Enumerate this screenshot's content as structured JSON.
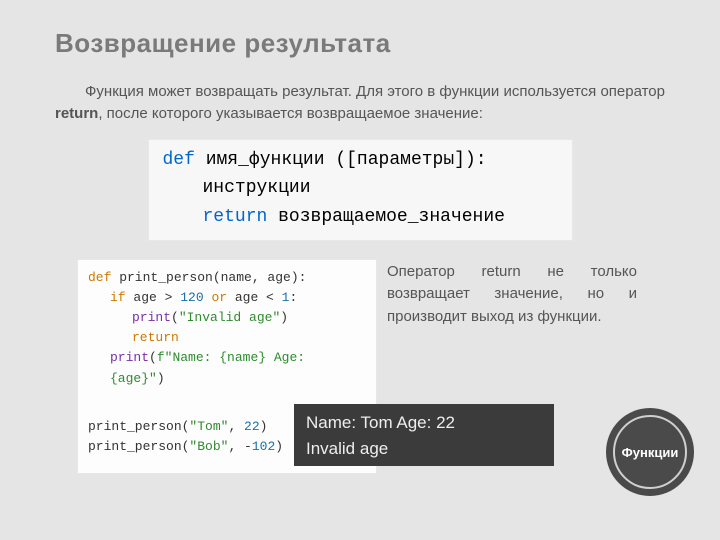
{
  "title": "Возвращение результата",
  "intro": {
    "pre": "Функция может возвращать результат. Для этого в функции используется оператор ",
    "bold": "return",
    "post": ", после которого указывается возвращаемое значение:"
  },
  "syntax": {
    "l1_kw": "def",
    "l1_rest": " имя_функции ([параметры]):",
    "l2": "инструкции",
    "l3_kw": "return",
    "l3_rest": " возвращаемое_значение"
  },
  "code": {
    "l1": {
      "kw": "def",
      "name": " print_person(name, age):"
    },
    "l2": {
      "kw": "if",
      "mid1": " age > ",
      "n1": "120",
      "mid2": " ",
      "kw2": "or",
      "mid3": " age < ",
      "n2": "1",
      "end": ":"
    },
    "l3": {
      "fn": "print",
      "open": "(",
      "str": "\"Invalid age\"",
      "close": ")"
    },
    "l4": {
      "kw": "return"
    },
    "l5": {
      "fn": "print",
      "open": "(",
      "pfx": "f",
      "str": "\"Name: {name}  Age: {age}\"",
      "close": ")"
    },
    "l7": {
      "name": "print_person(",
      "str": "\"Tom\"",
      "mid": ", ",
      "num": "22",
      "close": ")"
    },
    "l8": {
      "name": "print_person(",
      "str": "\"Bob\"",
      "mid": ", -",
      "num": "102",
      "close": ")"
    }
  },
  "right_text": "Оператор return не только возвращает значение, но и производит выход из функции.",
  "output": {
    "l1": "Name: Tom  Age: 22",
    "l2": "Invalid age"
  },
  "badge": "Функции"
}
